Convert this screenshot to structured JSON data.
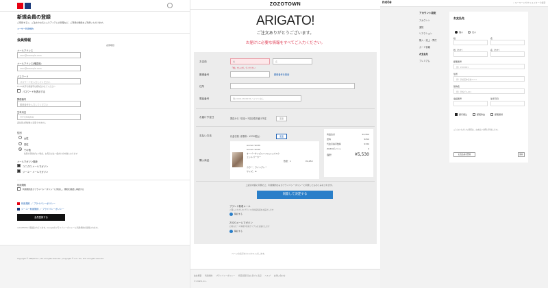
{
  "uniqlo": {
    "title": "新規会員の登録",
    "intro": "ご登録すると、ご注文やお気に入りアイテムの管理など、ご登録の機能をご利用いただけます。",
    "intro_link": "ユーザー利用規約",
    "section_title": "会員情報",
    "required_note": "必須項目",
    "fields": [
      {
        "label": "メールアドレス",
        "placeholder": "user@example.com"
      },
      {
        "label": "メールアドレス(確認用)",
        "placeholder": "user@example.com"
      },
      {
        "label": "パスワード",
        "placeholder": "パスワードを入力してください"
      },
      {
        "label": "郵便番号",
        "placeholder": "郵便番号を入力してください"
      },
      {
        "label": "生年月日",
        "placeholder": "YYYY/MM/DD"
      }
    ],
    "password_hint": "8〜20文字の英数字を組み合わせてください",
    "show_password": "パスワードを表示する",
    "birth_hint": "誕生日は登録後に変更できません",
    "gender_label": "性別",
    "genders": [
      "女性",
      "男性",
      "その他"
    ],
    "gender_hint": "性別の登録がない場合、お知らせは一般向けの内容になります",
    "mail_label": "メールマガジン購読",
    "mail_options": [
      "ユニクロ メールマガジン",
      "ジーユー メールマガジン"
    ],
    "agree_label": "利用規約",
    "agree_text": "利用規約及びプライバシーポリシーに同意し、規約を確認し承諾する",
    "links": [
      "利用規約",
      "プライバシーポリシー",
      "ジーユー利用規約",
      "プライバシーポリシー"
    ],
    "submit": "会員登録する",
    "bottom_note": "reCAPTCHAで保護されています。Googleのプライバシーポリシーと利用規約が適用されます。",
    "copyright": "Copyright © UNIQLO Co., Ltd. All rights reserved. | Copyright © G.U. CO., LTD. All rights reserved."
  },
  "zozo": {
    "logo": "ZOZOTOWN",
    "headline": "ARIGATO!",
    "thanks": "ご注文ありがとうございます。",
    "warning": "お届けに必要な情報をすべてご入力ください。",
    "name_label": "お名前",
    "last_name_placeholder": "姓",
    "first_name_placeholder": "名",
    "name_error": "「姓」を入力してください",
    "zip_label": "郵便番号",
    "zip_link": "郵便番号を検索",
    "address_label": "住所",
    "phone_label": "電話番号",
    "phone_placeholder": "例) 09012345678 ハイフンなし",
    "delivery_label": "お届け予定日",
    "delivery_text": "発送から 2日目〜3日目頃お届け予定",
    "delivery_btn": "変更",
    "payment_label": "支払い方法",
    "payment_text": "代金引換 (手数料：¥330税込)",
    "payment_btn": "変更",
    "summary": [
      {
        "label": "商品合計",
        "value": "¥4,950"
      },
      {
        "label": "送料",
        "value": "¥250"
      },
      {
        "label": "代金引換手数料",
        "value": "¥330"
      },
      {
        "label": "ZOZOポイント",
        "value": "0"
      }
    ],
    "total_label": "合計",
    "total_value": "¥5,530",
    "product_label": "購入商品",
    "product_brand": "Anchor Smith",
    "product_name": "オーバーサイズミニフルジップスウェットパーカー",
    "product_color": "カラー：ライトグレー",
    "product_size": "サイズ：M",
    "product_qty": "数量：1",
    "product_price": "¥4,950",
    "consent_text": "上記の内容に同意の上、利用規約およびプライバシーポリシーに同意したものとみなされます。",
    "cta": "同意して決定する",
    "option1_title": "ブランド新着メール",
    "option1_desc": "ご購入いただいたブランドの新着情報をお届けします",
    "option1_check": "購読する",
    "option2_title": "ZOZOメールマガジン",
    "option2_desc": "お得なセール情報や新着アイテムをお届けします",
    "option2_check": "購読する",
    "footer_note": "ページの表示をカスタマイズします。",
    "footer_links": [
      "会社概要",
      "利用規約",
      "プライバシーポリシー",
      "特定商取引法に基づく表記",
      "ヘルプ",
      "お問い合わせ"
    ],
    "copyright": "© ZOZO, Inc."
  },
  "note": {
    "logo": "note",
    "search_placeholder": "キーワードやクリエイターで検索",
    "sidebar": [
      "アカウント設定",
      "アカウント",
      "通知",
      "リアクション",
      "購入・売上・寄付",
      "カード情報",
      "お支払先",
      "プレミアム"
    ],
    "card_title": "お支払先",
    "radio_options": [
      "個人",
      "法人"
    ],
    "fields": [
      {
        "label": "姓",
        "placeholder": ""
      },
      {
        "label": "名",
        "placeholder": ""
      },
      {
        "label": "姓（カナ）",
        "placeholder": ""
      },
      {
        "label": "名（カナ）",
        "placeholder": ""
      },
      {
        "label": "郵便番号",
        "placeholder": "例）1500001"
      },
      {
        "label": "住所",
        "placeholder": "例）渋谷区神宮前1-2-3"
      },
      {
        "label": "建物名",
        "placeholder": "例）渋谷ビル101"
      },
      {
        "label": "電話番号",
        "placeholder": ""
      },
      {
        "label": "生年月日",
        "placeholder": ""
      }
    ],
    "checks": [
      "銀行振込",
      "郵便貯金",
      "郵便振替"
    ],
    "note_text": "ご入力いただいた情報は、お支払いの際に利用します。",
    "buttons": [
      "お支払先を登録",
      "保存"
    ]
  }
}
